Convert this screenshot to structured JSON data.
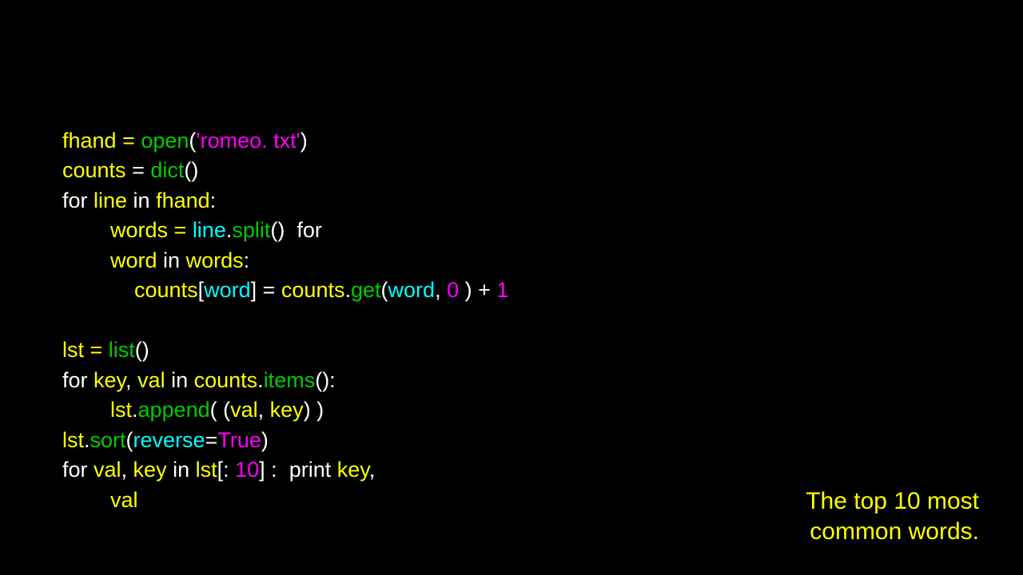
{
  "code": {
    "l1": {
      "a": "fhand = ",
      "b": "open",
      "c": "(",
      "d": "'romeo. txt'",
      "e": ")"
    },
    "l2": {
      "a": "counts ",
      "b": "= ",
      "c": "dict",
      "d": "()"
    },
    "l3": {
      "a": "for ",
      "b": "line ",
      "c": "in ",
      "d": "fhand",
      "e": ":"
    },
    "l4": {
      "a": "        words = ",
      "b": "line",
      "c": ".",
      "d": "split",
      "e": "()  ",
      "f": "for"
    },
    "l5": {
      "a": "        word ",
      "b": "in ",
      "c": "words",
      "d": ":"
    },
    "l6": {
      "a": "            counts",
      "b": "[",
      "c": "word",
      "d": "] = ",
      "e": "counts",
      "f": ".",
      "g": "get",
      "h": "(",
      "i": "word",
      "j": ", ",
      "k": "0 ",
      "l": ") + ",
      "m": "1"
    },
    "l7": "",
    "l8": {
      "a": "lst = ",
      "b": "list",
      "c": "()"
    },
    "l9": {
      "a": "for ",
      "b": "key",
      "c": ", ",
      "d": "val ",
      "e": "in ",
      "f": "counts",
      "g": ".",
      "h": "items",
      "i": "():"
    },
    "l10": {
      "a": "        lst",
      "b": ".",
      "c": "append",
      "d": "( (",
      "e": "val",
      "f": ", ",
      "g": "key",
      "h": ") )"
    },
    "l11": {
      "a": "lst",
      "b": ".",
      "c": "sort",
      "d": "(",
      "e": "reverse",
      "f": "=",
      "g": "True",
      "h": ")"
    },
    "l12": {
      "a": "for ",
      "b": "val",
      "c": ", ",
      "d": "key ",
      "e": "in ",
      "f": "lst",
      "g": "[: ",
      "h": "10",
      "i": "] :  ",
      "j": "print ",
      "k": "key",
      "l": ","
    },
    "l13": {
      "a": "        val"
    }
  },
  "caption": {
    "line1": "The top 10 most",
    "line2": "common words."
  }
}
